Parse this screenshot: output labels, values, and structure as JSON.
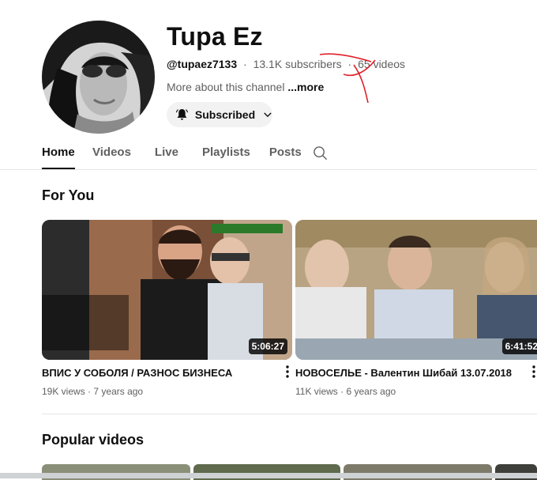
{
  "channel": {
    "name": "Tupa Ez",
    "handle": "@tupaez7133",
    "subscribers": "13.1K subscribers",
    "videos": "65 videos",
    "separator": "·",
    "about": "More about this channel",
    "about_more": "...more",
    "subscribe_label": "Subscribed"
  },
  "tabs": [
    {
      "label": "Home",
      "active": true
    },
    {
      "label": "Videos",
      "active": false
    },
    {
      "label": "Live",
      "active": false
    },
    {
      "label": "Playlists",
      "active": false
    },
    {
      "label": "Posts",
      "active": false
    }
  ],
  "sections": {
    "for_you": "For You",
    "popular": "Popular videos"
  },
  "videos": [
    {
      "title": "ВПИС У СОБОЛЯ / РАЗНОС БИЗНЕСА",
      "views": "19K views",
      "age": "7 years ago",
      "duration": "5:06:27"
    },
    {
      "title": "НОВОСЕЛЬЕ - Валентин Шибай 13.07.2018",
      "views": "11K views",
      "age": "6 years ago",
      "duration": "6:41:52"
    }
  ],
  "colors": {
    "annotation": "#e0202a",
    "text_primary": "#0f0f0f",
    "text_secondary": "#606060"
  },
  "icons": {
    "bell": "bell-icon",
    "chevron": "chevron-down-icon",
    "search": "search-icon",
    "more": "more-vert-icon"
  }
}
